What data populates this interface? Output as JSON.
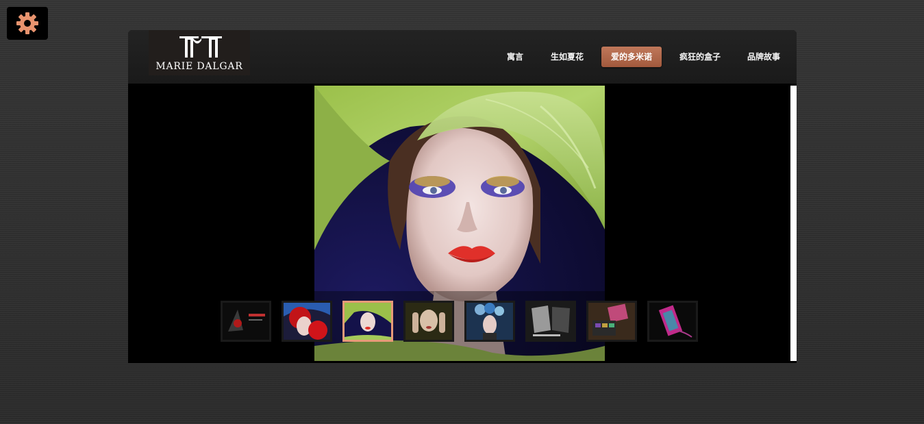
{
  "settings": {
    "icon": "gear-icon",
    "color": "#e8936e"
  },
  "brand": {
    "name": "MARIE DALGAR",
    "logo_icon": "mm-monogram-logo"
  },
  "nav": {
    "items": [
      {
        "label": "寓言"
      },
      {
        "label": "生如夏花"
      },
      {
        "label": "爱的多米诺",
        "active": true
      },
      {
        "label": "疯狂的盒子"
      },
      {
        "label": "品牌故事"
      }
    ]
  },
  "gallery": {
    "main_image": "woman-green-hat-photo",
    "thumbnails": [
      {
        "name": "makeup-product-dark-thumb",
        "active": false
      },
      {
        "name": "red-headdress-model-thumb",
        "active": false
      },
      {
        "name": "green-hat-model-thumb",
        "active": true
      },
      {
        "name": "hands-face-model-thumb",
        "active": false
      },
      {
        "name": "flower-crown-model-thumb",
        "active": false
      },
      {
        "name": "palette-box-thumb",
        "active": false
      },
      {
        "name": "eyeshadow-palette-thumb",
        "active": false
      },
      {
        "name": "colorful-case-thumb",
        "active": false
      }
    ]
  },
  "colors": {
    "accent": "#b0684a",
    "thumb_active_border": "#e89a78"
  }
}
